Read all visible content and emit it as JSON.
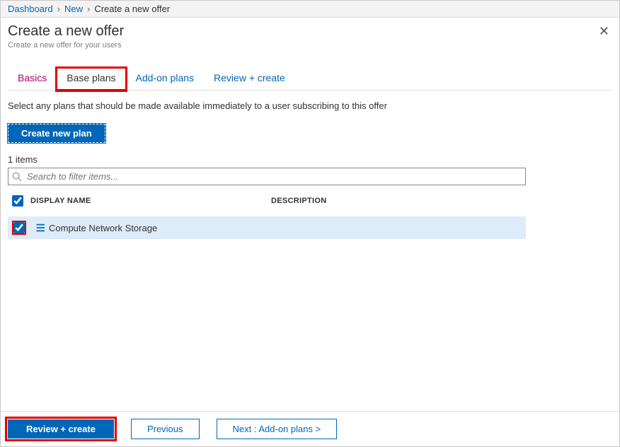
{
  "breadcrumb": {
    "items": [
      {
        "label": "Dashboard",
        "link": true
      },
      {
        "label": "New",
        "link": true
      },
      {
        "label": "Create a new offer",
        "link": false
      }
    ]
  },
  "header": {
    "title": "Create a new offer",
    "subtitle": "Create a new offer for your users"
  },
  "tabs": [
    {
      "label": "Basics",
      "state": "visited"
    },
    {
      "label": "Base plans",
      "state": "active",
      "highlight": true
    },
    {
      "label": "Add-on plans",
      "state": "link"
    },
    {
      "label": "Review + create",
      "state": "link"
    }
  ],
  "body": {
    "description": "Select any plans that should be made available immediately to a user subscribing to this offer",
    "create_plan_label": "Create new plan",
    "item_count_text": "1 items",
    "search_placeholder": "Search to filter items..."
  },
  "table": {
    "columns": {
      "display_name": "DISPLAY NAME",
      "description": "DESCRIPTION"
    },
    "header_checked": true,
    "rows": [
      {
        "checked": true,
        "highlight_checkbox": true,
        "display_name": "Compute Network Storage",
        "description": ""
      }
    ]
  },
  "footer": {
    "review_create": "Review + create",
    "previous": "Previous",
    "next": "Next : Add-on plans >"
  }
}
